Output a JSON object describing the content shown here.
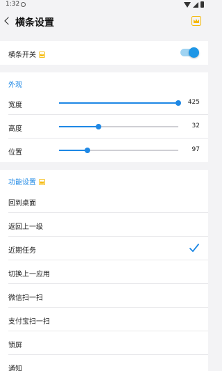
{
  "statusbar": {
    "time": "1:32"
  },
  "appbar": {
    "title": "横条设置"
  },
  "toggle_section": {
    "label": "横条开关",
    "enabled": true
  },
  "appearance": {
    "header": "外观",
    "sliders": [
      {
        "label": "宽度",
        "value": "425",
        "fraction": 1.0
      },
      {
        "label": "高度",
        "value": "32",
        "fraction": 0.33
      },
      {
        "label": "位置",
        "value": "97",
        "fraction": 0.24
      }
    ]
  },
  "functions": {
    "header": "功能设置",
    "items": [
      {
        "label": "回到桌面",
        "selected": false
      },
      {
        "label": "返回上一级",
        "selected": false
      },
      {
        "label": "近期任务",
        "selected": true
      },
      {
        "label": "切换上一应用",
        "selected": false
      },
      {
        "label": "微信扫一扫",
        "selected": false
      },
      {
        "label": "支付宝扫一扫",
        "selected": false
      },
      {
        "label": "锁屏",
        "selected": false
      },
      {
        "label": "通知",
        "selected": false
      }
    ]
  },
  "colors": {
    "accent": "#1e88e5",
    "toggle_track": "#9fd3f2",
    "crown": "#f5b700"
  }
}
